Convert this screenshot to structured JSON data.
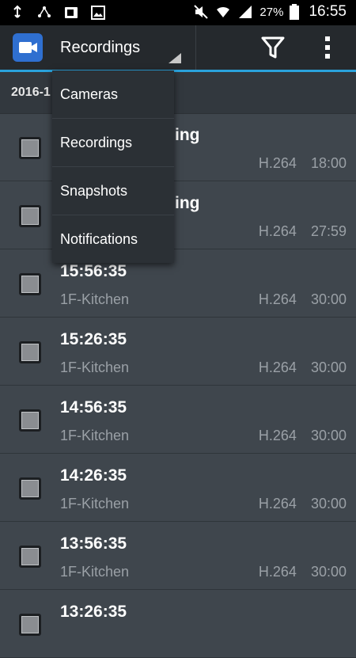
{
  "status_bar": {
    "battery_percent": "27%",
    "time": "16:55",
    "icons": [
      "usb-icon",
      "network-icon",
      "office-icon",
      "image-icon",
      "mute-icon",
      "wifi-icon",
      "signal-icon",
      "battery-icon"
    ]
  },
  "action_bar": {
    "spinner_label": "Recordings",
    "icons": [
      "app-camera-icon",
      "filter-icon",
      "overflow-menu-icon"
    ],
    "accent_color": "#2aa2dc"
  },
  "date_header": {
    "label": "2016-1"
  },
  "dropdown": {
    "items": [
      {
        "label": "Cameras"
      },
      {
        "label": "Recordings"
      },
      {
        "label": "Snapshots"
      },
      {
        "label": "Notifications"
      }
    ]
  },
  "rows": [
    {
      "time": "rding",
      "camera": "",
      "codec": "H.264",
      "duration": "18:00"
    },
    {
      "time": "rding",
      "camera": "",
      "codec": "H.264",
      "duration": "27:59"
    },
    {
      "time": "15:56:35",
      "camera": "1F-Kitchen",
      "codec": "H.264",
      "duration": "30:00"
    },
    {
      "time": "15:26:35",
      "camera": "1F-Kitchen",
      "codec": "H.264",
      "duration": "30:00"
    },
    {
      "time": "14:56:35",
      "camera": "1F-Kitchen",
      "codec": "H.264",
      "duration": "30:00"
    },
    {
      "time": "14:26:35",
      "camera": "1F-Kitchen",
      "codec": "H.264",
      "duration": "30:00"
    },
    {
      "time": "13:56:35",
      "camera": "1F-Kitchen",
      "codec": "H.264",
      "duration": "30:00"
    },
    {
      "time": "13:26:35",
      "camera": "",
      "codec": "",
      "duration": ""
    }
  ]
}
